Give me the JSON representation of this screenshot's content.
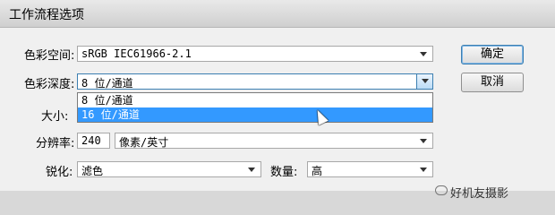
{
  "window": {
    "title": "工作流程选项"
  },
  "rows": {
    "color_space": {
      "label": "色彩空间:",
      "value": "sRGB IEC61966-2.1"
    },
    "color_depth": {
      "label": "色彩深度:",
      "value": "8 位/通道"
    },
    "size": {
      "label": "大小:"
    },
    "resolution": {
      "label": "分辨率:",
      "value": "240",
      "unit": "像素/英寸"
    },
    "sharpen": {
      "label": "锐化:",
      "value": "滤色",
      "amount_label": "数量:",
      "amount_value": "高"
    }
  },
  "depth_options": [
    "8 位/通道",
    "16 位/通道"
  ],
  "selected_option_index": 1,
  "buttons": {
    "ok": "确定",
    "cancel": "取消"
  },
  "watermark": {
    "text": "好机友摄影"
  },
  "colors": {
    "highlight": "#3399ff",
    "dialog_bg": "#f0f0f0"
  }
}
